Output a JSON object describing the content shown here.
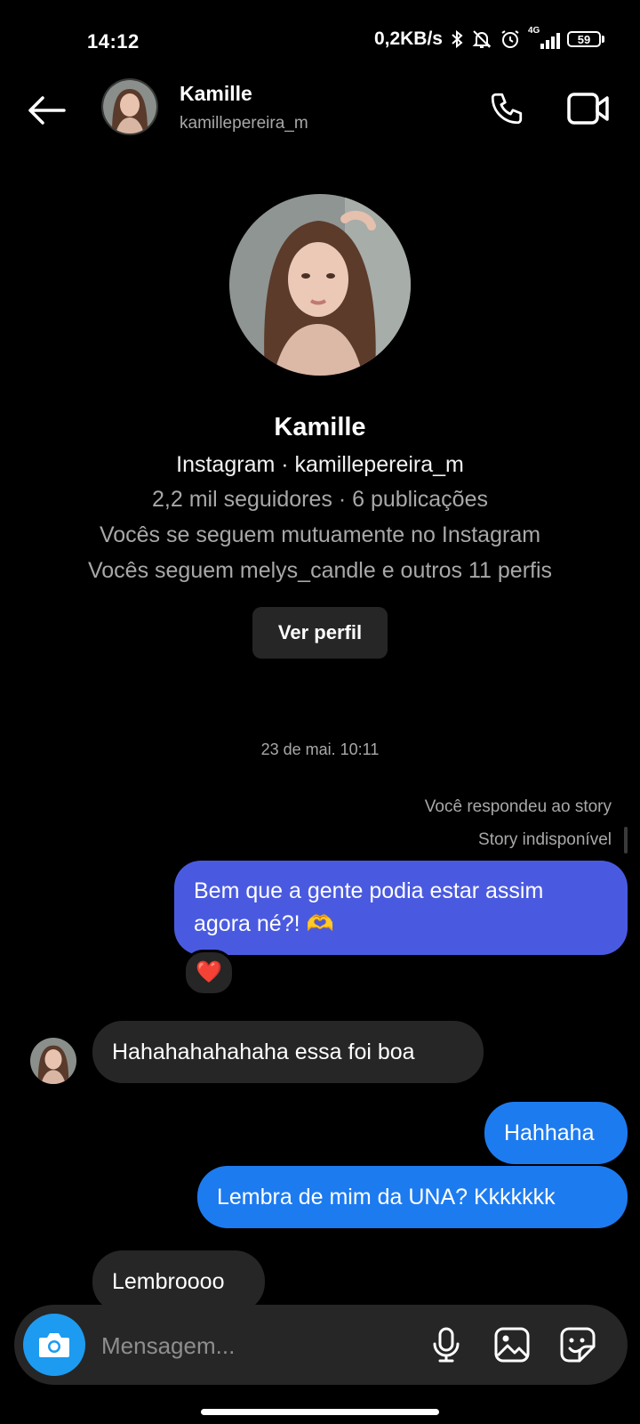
{
  "status_bar": {
    "time": "14:12",
    "net_speed": "0,2KB/s",
    "network_type": "4G",
    "battery": "59",
    "icons": [
      "bluetooth-icon",
      "mute-bell-icon",
      "alarm-icon",
      "signal-icon",
      "battery-icon"
    ]
  },
  "header": {
    "name": "Kamille",
    "username": "kamillepereira_m",
    "icons": [
      "back-arrow-icon",
      "phone-icon",
      "video-camera-icon"
    ]
  },
  "profile": {
    "name": "Kamille",
    "line1": "Instagram · kamillepereira_m",
    "line2": "2,2 mil seguidores · 6 publicações",
    "line3": "Vocês se seguem mutuamente no Instagram",
    "line4": "Vocês seguem melys_candle e outros 11 perfis",
    "button_label": "Ver perfil"
  },
  "conversation": {
    "timestamp": "23 de mai. 10:11",
    "story_reply_note": "Você respondeu ao story",
    "story_unavailable": "Story indisponível",
    "messages": [
      {
        "from": "me",
        "text_line1": "Bem que a gente podia estar assim",
        "text_line2": "agora né?! 🫶",
        "reaction": "❤️"
      },
      {
        "from": "them",
        "text": "Hahahahahahaha essa foi boa"
      },
      {
        "from": "me",
        "text": "Hahhaha"
      },
      {
        "from": "me",
        "text": "Lembra de mim da UNA? Kkkkkkk"
      },
      {
        "from": "them",
        "text": "Lembroooo"
      }
    ]
  },
  "composer": {
    "placeholder": "Mensagem...",
    "icons": [
      "camera-icon",
      "microphone-icon",
      "gallery-icon",
      "sticker-icon"
    ]
  },
  "colors": {
    "background": "#000000",
    "incoming_bubble": "#262626",
    "outgoing_bubble": "#1d7bf0",
    "outgoing_bubble_gradient": "#4a5ae0",
    "camera_button": "#1d9bf0"
  }
}
